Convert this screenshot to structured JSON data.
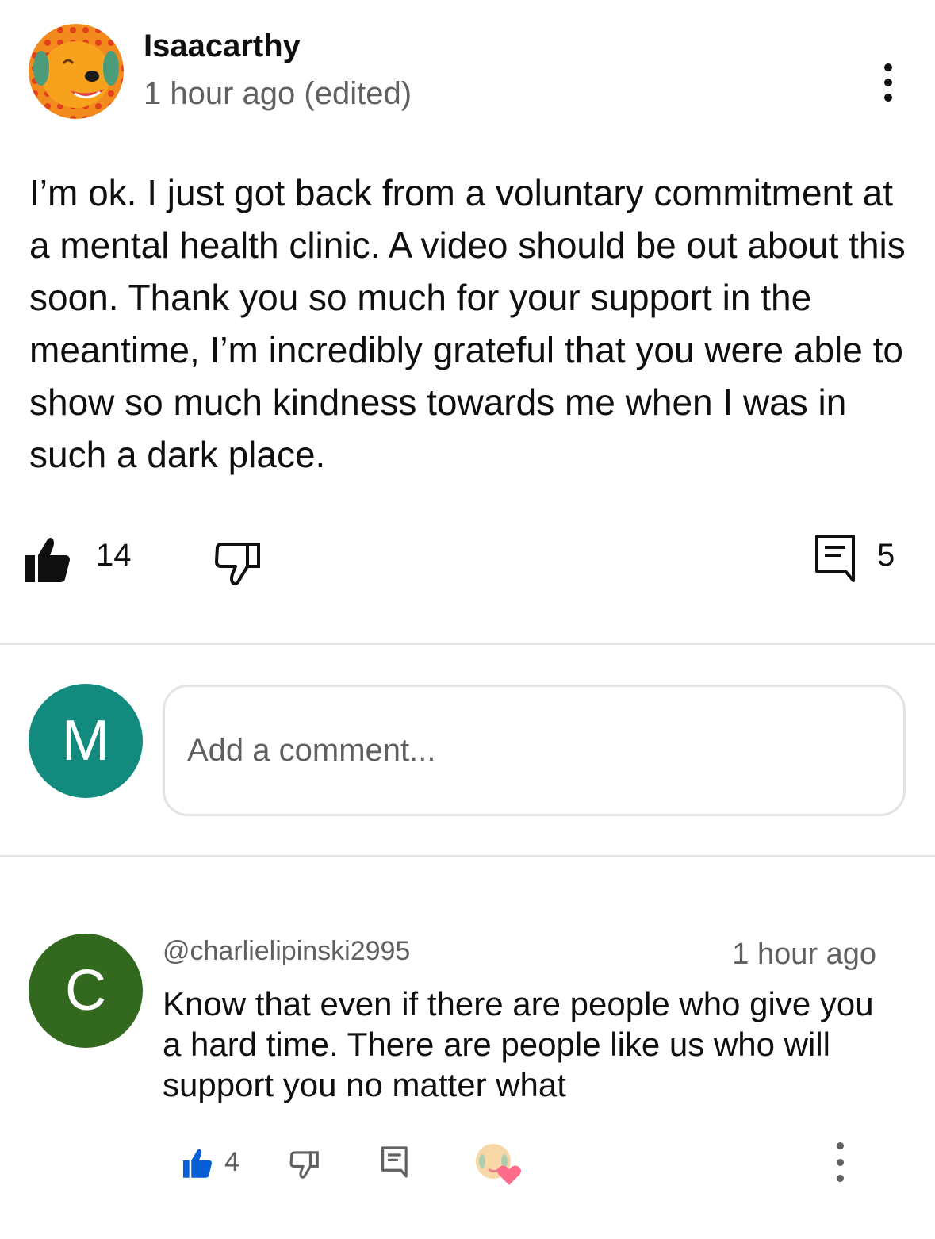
{
  "comment": {
    "author": "Isaacarthy",
    "meta": "1 hour ago (edited)",
    "text": "I’m ok. I just got back from a voluntary commitment at a mental health clinic. A video should be out about this soon. Thank you so much for your support in the meantime, I’m incredibly grateful that you were able to show so much kindness towards me when I was in such a dark place.",
    "like_count": "14",
    "reply_count": "5",
    "avatar_icon": "dog-avatar-icon"
  },
  "add_comment": {
    "avatar_letter": "M",
    "avatar_color": "#138a7e",
    "placeholder": "Add a comment..."
  },
  "reply": {
    "avatar_letter": "C",
    "avatar_color": "#33691e",
    "handle": "@charlielipinski2995",
    "time": "1 hour ago",
    "text": "Know that even if there are people who give you a hard time. There are people like us who will support you no matter what",
    "like_count": "4",
    "liked_color": "#065fd4",
    "hearted": true
  }
}
